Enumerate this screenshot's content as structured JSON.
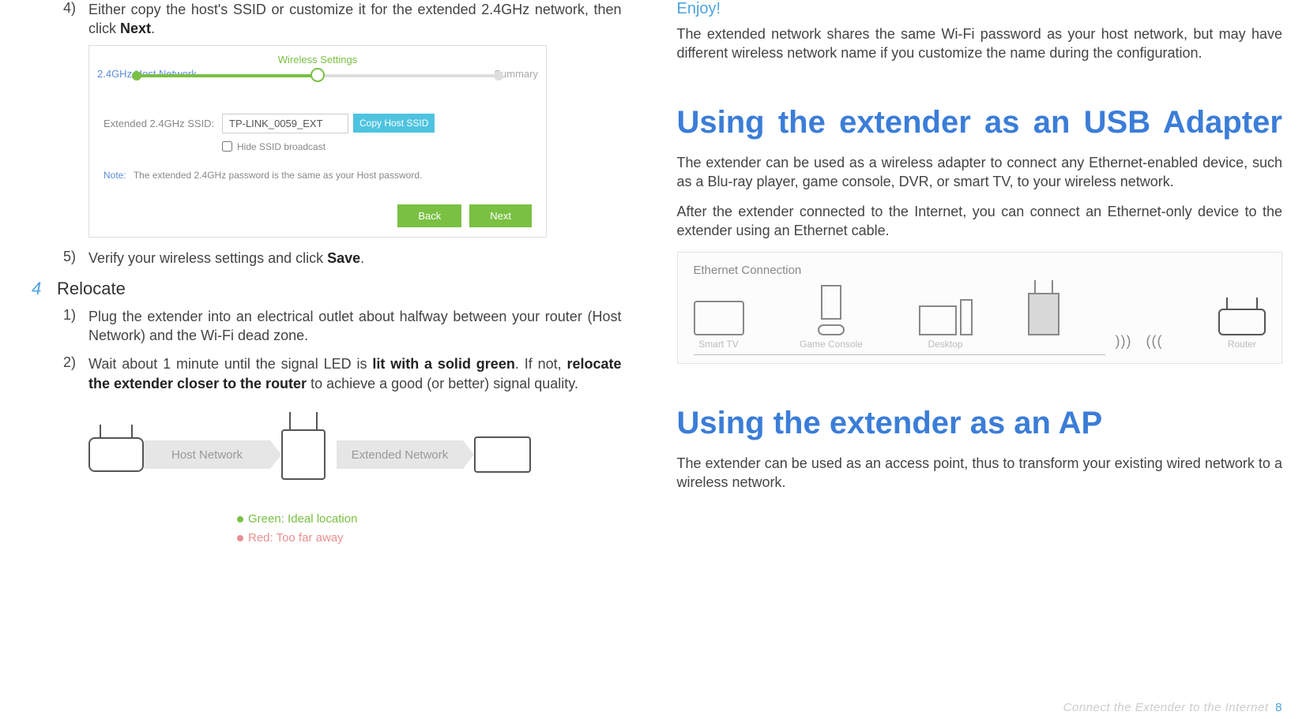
{
  "left": {
    "step4_num": "4)",
    "step4_a": "Either copy the host's SSID or customize it for the extended 2.4GHz network, then click ",
    "step4_b": "Next",
    "step4_c": ".",
    "panel": {
      "ws": "Wireless Settings",
      "host": "2.4GHz Host Network",
      "summary": "Summary",
      "ssid_lbl": "Extended 2.4GHz SSID:",
      "ssid_val": "TP-LINK_0059_EXT",
      "copy": "Copy Host SSID",
      "hide": "Hide SSID broadcast",
      "note_lbl": "Note:",
      "note_txt": "The extended 2.4GHz password is the same as your Host password.",
      "back": "Back",
      "next": "Next"
    },
    "step5_num": "5)",
    "step5_a": "Verify your wireless settings and click ",
    "step5_b": "Save",
    "step5_c": ".",
    "sec_num": "4",
    "sec_title": "Relocate",
    "r1_num": "1)",
    "r1_txt": "Plug the extender into an electrical outlet about halfway between your router (Host Network) and the Wi-Fi dead zone.",
    "r2_num": "2)",
    "r2_a": "Wait about 1 minute until the signal LED is ",
    "r2_b": "lit with a solid green",
    "r2_c": ". If not, ",
    "r2_d": "relocate the extender closer to the router",
    "r2_e": " to achieve a good (or better) signal quality.",
    "diag": {
      "hostnet": "Host Network",
      "extnet": "Extended Network",
      "green": "Green: Ideal location",
      "red": "Red: Too far away"
    }
  },
  "right": {
    "enjoy": "Enjoy!",
    "enjoy_p": "The extended network shares the same Wi-Fi password as your host network, but may have different wireless network name if you customize the name during the configuration.",
    "h1_usb": "Using the extender as an USB Adapter",
    "usb_p1": "The extender can be used as a wireless adapter to connect any Ethernet-enabled device, such as a Blu-ray player, game console, DVR, or smart TV, to your wireless network.",
    "usb_p2": "After the extender connected to the Internet, you can connect an Ethernet-only device to the extender using an Ethernet cable.",
    "diag": {
      "title": "Ethernet Connection",
      "tv": "Smart TV",
      "console": "Game Console",
      "desktop": "Desktop",
      "router": "Router"
    },
    "h1_ap": "Using the extender as an AP",
    "ap_p": "The extender can be used as an access point, thus to transform your existing wired network to a wireless network."
  },
  "footer": {
    "txt": "Connect the Extender to the Internet",
    "page": "8"
  }
}
